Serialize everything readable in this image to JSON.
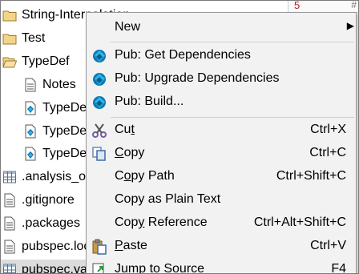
{
  "tree": {
    "items": [
      {
        "label": "String-Interpolation",
        "icon": "folder-icon",
        "indent": 0,
        "selected": false
      },
      {
        "label": "Test",
        "icon": "folder-icon",
        "indent": 0,
        "selected": false
      },
      {
        "label": "TypeDef",
        "icon": "folder-open-icon",
        "indent": 0,
        "selected": false
      },
      {
        "label": "Notes",
        "icon": "text-file-icon",
        "indent": 1,
        "selected": false
      },
      {
        "label": "TypeDef",
        "icon": "dart-file-icon",
        "indent": 1,
        "selected": false
      },
      {
        "label": "TypeDef",
        "icon": "dart-file-icon",
        "indent": 1,
        "selected": false
      },
      {
        "label": "TypeDef",
        "icon": "dart-file-icon",
        "indent": 1,
        "selected": false
      },
      {
        "label": ".analysis_options",
        "icon": "table-file-icon",
        "indent": 0,
        "selected": false
      },
      {
        "label": ".gitignore",
        "icon": "text-file-icon",
        "indent": 0,
        "selected": false
      },
      {
        "label": ".packages",
        "icon": "text-file-icon",
        "indent": 0,
        "selected": false
      },
      {
        "label": "pubspec.lock",
        "icon": "text-file-icon",
        "indent": 0,
        "selected": false
      },
      {
        "label": "pubspec.yaml",
        "icon": "table-file-icon",
        "indent": 0,
        "selected": true
      }
    ]
  },
  "editor_strip": {
    "line_number": "5",
    "marker": "#"
  },
  "menu": {
    "new": {
      "label": "New",
      "arrow": "▶"
    },
    "pub_get": {
      "label": "Pub: Get Dependencies",
      "icon": "dart-logo-icon"
    },
    "pub_upgrade": {
      "label": "Pub: Upgrade Dependencies",
      "icon": "dart-logo-icon"
    },
    "pub_build": {
      "label": "Pub: Build...",
      "icon": "dart-logo-icon"
    },
    "cut": {
      "pre": "Cu",
      "mnemonic": "t",
      "post": "",
      "shortcut": "Ctrl+X",
      "icon": "scissors-icon"
    },
    "copy": {
      "pre": "",
      "mnemonic": "C",
      "post": "opy",
      "shortcut": "Ctrl+C",
      "icon": "copy-icon"
    },
    "copy_path": {
      "pre": "C",
      "mnemonic": "o",
      "post": "py Path",
      "shortcut": "Ctrl+Shift+C"
    },
    "copy_plain": {
      "label": "Copy as Plain Text"
    },
    "copy_reference": {
      "pre": "Cop",
      "mnemonic": "y",
      "post": " Reference",
      "shortcut": "Ctrl+Alt+Shift+C"
    },
    "paste": {
      "pre": "",
      "mnemonic": "P",
      "post": "aste",
      "shortcut": "Ctrl+V",
      "icon": "paste-icon"
    },
    "jump": {
      "label": "Jump to Source",
      "shortcut": "F4",
      "icon": "jump-source-icon"
    }
  }
}
